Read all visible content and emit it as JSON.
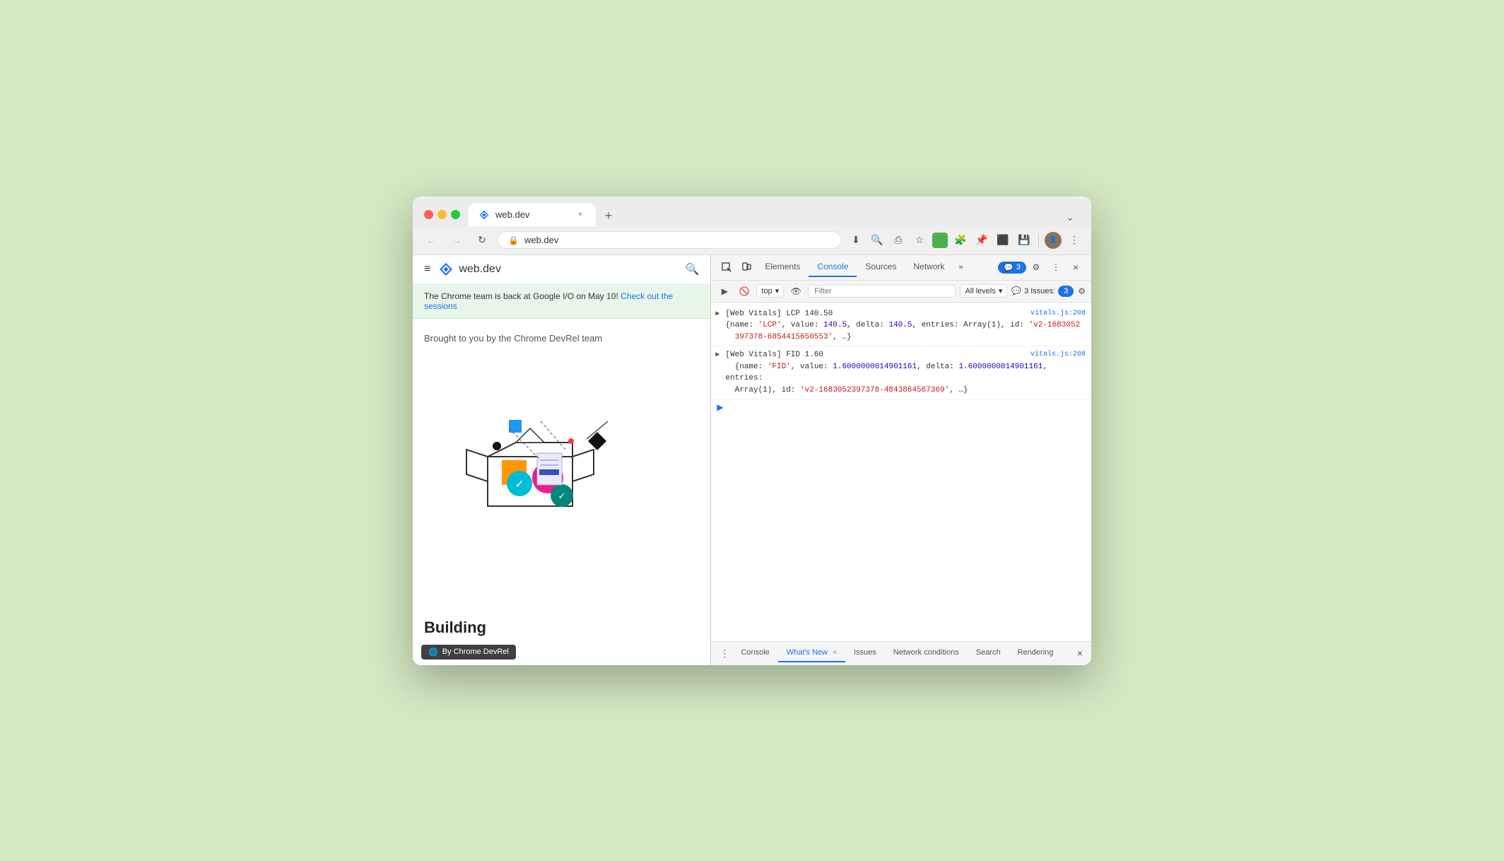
{
  "browser": {
    "tab_title": "web.dev",
    "tab_close": "×",
    "new_tab": "+",
    "tab_menu": "⌄",
    "url": "web.dev",
    "lock_icon": "🔒"
  },
  "toolbar": {
    "back": "←",
    "forward": "→",
    "refresh": "↻",
    "download": "⬇",
    "zoom": "🔍",
    "share": "⎙",
    "bookmark": "☆",
    "extensions": "🧩",
    "pin": "📌",
    "cast": "📡",
    "more": "⋮"
  },
  "webpage": {
    "menu_icon": "≡",
    "site_name": "web.dev",
    "search_icon": "🔍",
    "banner_text": "The Chrome team is back at Google I/O on May 10!",
    "banner_link": "Check out the sessions",
    "credit_text": "Brought to you by the Chrome DevRel team",
    "heading": "Building a better web, together",
    "footer_badge": "By  Chrome DevRel"
  },
  "devtools": {
    "tabs": [
      {
        "label": "Elements",
        "active": false
      },
      {
        "label": "Console",
        "active": true
      },
      {
        "label": "Sources",
        "active": false
      },
      {
        "label": "Network",
        "active": false
      }
    ],
    "more_tabs": "»",
    "issues_count": "3",
    "issues_label": "3 Issues:",
    "settings_icon": "⚙",
    "more_icon": "⋮",
    "close": "×",
    "inspect_icon": "⬚",
    "device_icon": "📱"
  },
  "console_toolbar": {
    "clear_icon": "🚫",
    "play_icon": "▶",
    "context": "top",
    "eye_icon": "👁",
    "filter_placeholder": "Filter",
    "levels": "All levels",
    "issues_text": "3 Issues:",
    "issues_badge_count": "3",
    "gear_icon": "⚙"
  },
  "console_output": {
    "entry1": {
      "header": "[Web Vitals] LCP 140.50",
      "source": "vitals.js:208",
      "body": "{name: 'LCP', value: 140.5, delta: 140.5, entries: Array(1), id: 'v2-1683052 397378-6854415650553', …}"
    },
    "entry2": {
      "header": "[Web Vitals] FID 1.60",
      "source": "vitals.js:208",
      "body": "{name: 'FID', value: 1.6000000014901161, delta: 1.6000000014901161, entries: Array(1), id: 'v2-1683052397378-4843864567369', …}"
    },
    "lcp_value": "140.5",
    "lcp_delta": "140.5",
    "fid_name": "FID",
    "fid_value": "1.6000000014901161",
    "fid_delta": "1.6000000014901161"
  },
  "bottom_tabs": [
    {
      "label": "Console",
      "active": false,
      "closeable": false
    },
    {
      "label": "What's New",
      "active": true,
      "closeable": true
    },
    {
      "label": "Issues",
      "active": false,
      "closeable": false
    },
    {
      "label": "Network conditions",
      "active": false,
      "closeable": false
    },
    {
      "label": "Search",
      "active": false,
      "closeable": false
    },
    {
      "label": "Rendering",
      "active": false,
      "closeable": false
    }
  ]
}
